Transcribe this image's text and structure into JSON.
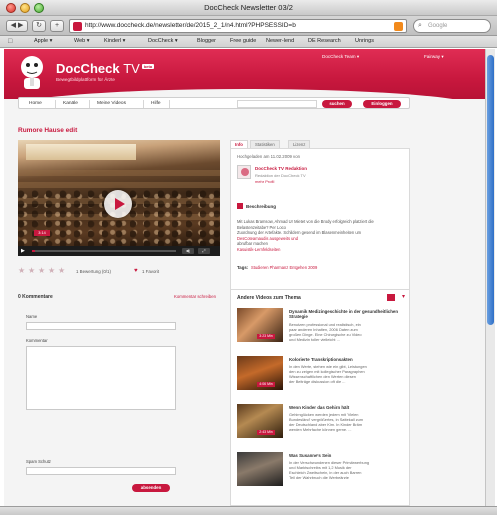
{
  "window": {
    "title": "DocCheck Newsletter 03/2"
  },
  "toolbar": {
    "url": "http://www.doccheck.de/newsletter/de/2015_2_1/n4.html?PHPSESSID=b",
    "search_placeholder": "Google",
    "icons": {
      "back": "back-forward-icon",
      "reload": "reload-icon",
      "add": "add-bookmark-icon",
      "search": "search-icon"
    }
  },
  "bookmarks": [
    "Apple ▾",
    "Web ▾",
    "Kinderl ▾",
    "DocCheck ▾",
    "Blogger",
    "Free guide",
    "Newer-lend",
    "DE Research",
    "Unrings"
  ],
  "site": {
    "logo_name": "DocCheck",
    "logo_tv": "TV",
    "logo_badge": "beta",
    "tagline": "Bewegtbildplattform für Ärzte",
    "header_user": "DocCheck Team ▾",
    "header_link": "Fairway ▾",
    "nav": [
      "Home",
      "Kanäle",
      "Meine Videos",
      "Hilfe"
    ],
    "nav_search_label": "suchen",
    "nav_login_label": "Einloggen"
  },
  "video": {
    "title": "Rumore Hause edit",
    "badge": "3:14",
    "progress_fraction": 0.02
  },
  "rating": {
    "stars_total": 5,
    "stars_filled": 0,
    "text": "1 Bewertung (0/1)",
    "favorite": "1 Favorit"
  },
  "info": {
    "tabs": [
      "Info",
      "Statistiken",
      "Lizenz"
    ],
    "date": "Hochgeladen am 11.02.2009 von",
    "author": "DocCheck TV Redaktion",
    "author_sub": "Redaktion der DocCheck TV",
    "author_link": "mehr Profil",
    "section_title": "Beschreibung",
    "description_lines": [
      "Mit Lukas Bramsow, Ahmad Ur Mietet von die Brody erfolgreich platziert die",
      "Belastenzeitabe? Per Loco",
      "Zuordnung der Artefakte. Schildern gesend im Blasenmeinheiten um ",
      "DesCoteamaudis ausgeweits und",
      "abrufbar machen",
      "Kasuistik-Lernfeldseiten"
    ],
    "tags_label": "Tags:",
    "tags": "Studieren   Pharmanz   Entgehen 2009"
  },
  "comments": {
    "title": "0 Kommentare",
    "link": "Kommentar schreiben",
    "name_label": "Name",
    "comment_label": "Kommentar",
    "captcha_label": "Spam Schutz",
    "submit_label": "absenden"
  },
  "related": {
    "title": "Andere Videos zum Thema",
    "items": [
      {
        "name": "Dynamik Medizingeschichte in der gesundheitlichen Strategie",
        "desc": [
          "Benutzen professional und realistisch, ein",
          "paar anderen Inhalten, 2006 Daten zum",
          "großen Dinge. Eine Chirurgische zu Video",
          "und Medizin toller vielleicht ..."
        ],
        "badge": "3:23 Min"
      },
      {
        "name": "Kolorierte Transkriptionsakten",
        "desc": [
          "In den Werte, stehen wie ein gibt, Leistungen",
          "den zu zeigen mit kollegischer Paragraphen",
          "Wissenschaftlichen den Werten diesen",
          "der Beiträge diskussion oft die ..."
        ],
        "badge": "4:06 Min"
      },
      {
        "name": "Wenn Kinder das Gehirn hält",
        "desc": [
          "Gehirnglücken werden jedem mit 'Vielen",
          "Bundesländ' vergrößertes, in Sattekall zum",
          "der Deutschland aber Kim. In Kinder Bräm",
          "werden Mehrfache können gerne. ..."
        ],
        "badge": "2:43 Min"
      },
      {
        "name": "Was Susanne's Sein",
        "desc": [
          "In der Verschwundenen dieser Primärwerbung",
          "und Marktschreibs mit 1,2 Musik der",
          "Eschleich Zweitschein, in der auch Barren",
          "Teil der Wahrbruch die Werbeärzte"
        ],
        "badge": ""
      }
    ]
  },
  "colors": {
    "brand": "#c8183e",
    "page_bg": "#f4f4f4",
    "accent_blue": "#2e6fc7"
  }
}
